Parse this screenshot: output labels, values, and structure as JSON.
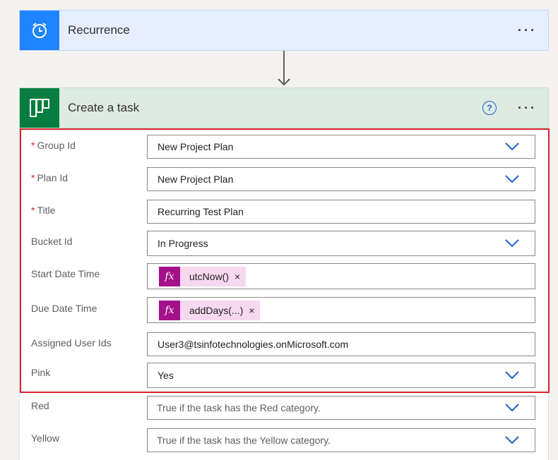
{
  "recurrence": {
    "title": "Recurrence",
    "menu": "···"
  },
  "task": {
    "title": "Create a task",
    "help": "?",
    "menu": "···"
  },
  "fields": {
    "group_id": {
      "label": "Group Id",
      "required": "*",
      "value": "New Project Plan"
    },
    "plan_id": {
      "label": "Plan Id",
      "required": "*",
      "value": "New Project Plan"
    },
    "title": {
      "label": "Title",
      "required": "*",
      "value": "Recurring Test Plan"
    },
    "bucket_id": {
      "label": "Bucket Id",
      "value": "In Progress"
    },
    "start_date_time": {
      "label": "Start Date Time",
      "token_icon": "fx",
      "token": "utcNow()",
      "remove": "×"
    },
    "due_date_time": {
      "label": "Due Date Time",
      "token_icon": "fx",
      "token": "addDays(...)",
      "remove": "×"
    },
    "assigned_user_ids": {
      "label": "Assigned User Ids",
      "value": "User3@tsinfotechnologies.onMicrosoft.com"
    },
    "pink": {
      "label": "Pink",
      "value": "Yes"
    },
    "red": {
      "label": "Red",
      "placeholder": "True if the task has the Red category."
    },
    "yellow": {
      "label": "Yellow",
      "placeholder": "True if the task has the Yellow category."
    }
  },
  "colors": {
    "recurrence_accent": "#1f85ff",
    "planner_accent": "#077d3f",
    "highlight": "#d9222b",
    "token": "#a5118b"
  }
}
